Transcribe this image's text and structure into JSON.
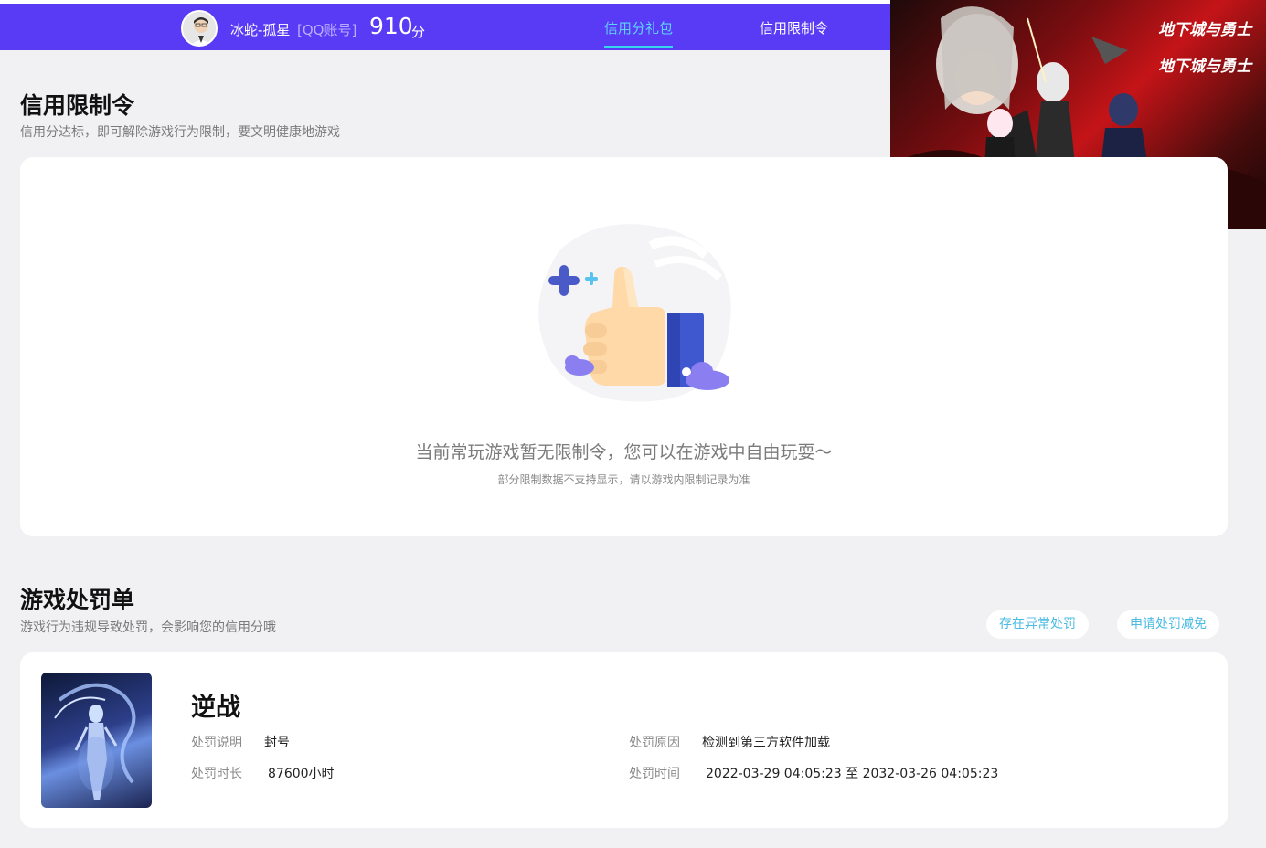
{
  "header": {
    "user_name": "冰蛇-孤星",
    "account_type": "[QQ账号]",
    "score": "910",
    "score_unit": "分",
    "tabs": [
      {
        "label": "信用分礼包",
        "active": true
      },
      {
        "label": "信用限制令",
        "active": false
      }
    ],
    "accent_color": "#5a3bf5",
    "active_tab_color": "#5fd3ff"
  },
  "banner": {
    "logo_text_1": "地下城与勇士",
    "logo_text_2": "地下城与勇士"
  },
  "restriction": {
    "title": "信用限制令",
    "subtitle": "信用分达标，即可解除游戏行为限制，要文明健康地游戏",
    "empty_main": "当前常玩游戏暂无限制令，您可以在游戏中自由玩耍～",
    "empty_sub": "部分限制数据不支持显示，请以游戏内限制记录为准",
    "illustration_icon": "thumbs-up-icon"
  },
  "penalty": {
    "title": "游戏处罚单",
    "subtitle": "游戏行为违规导致处罚，会影响您的信用分哦",
    "buttons": {
      "abnormal": "存在异常处罚",
      "appeal": "申请处罚减免"
    },
    "item": {
      "game_name": "逆战",
      "desc_label": "处罚说明",
      "desc_value": "封号",
      "reason_label": "处罚原因",
      "reason_value": "检测到第三方软件加载",
      "duration_label": "处罚时长",
      "duration_value": "87600小时",
      "time_label": "处罚时间",
      "time_value": "2022-03-29 04:05:23 至 2032-03-26 04:05:23"
    }
  }
}
